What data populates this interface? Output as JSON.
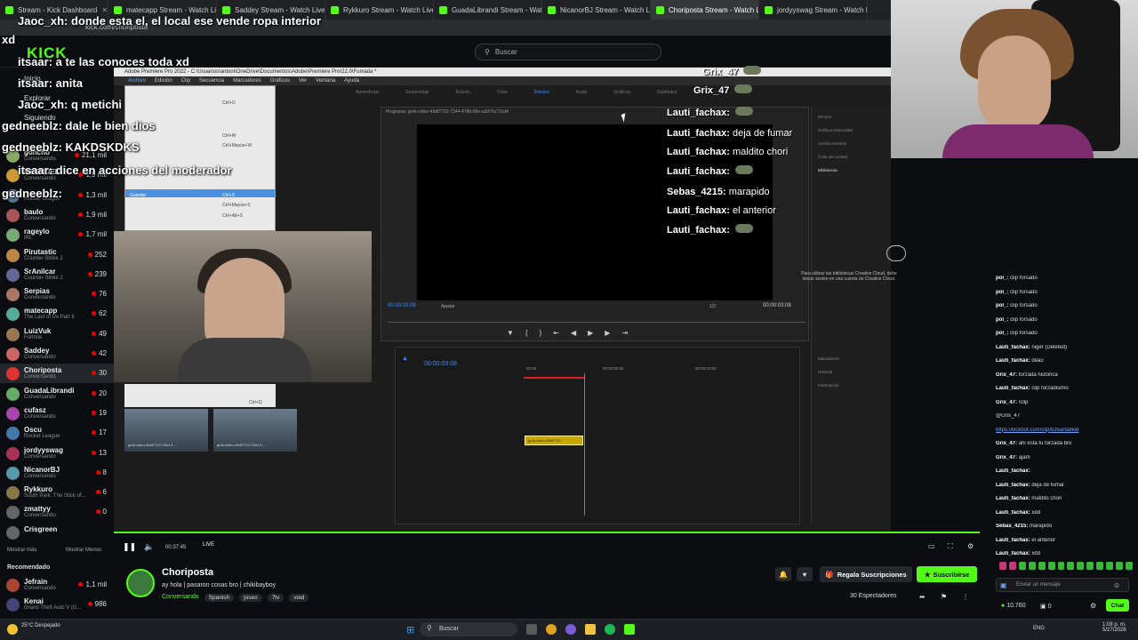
{
  "browser": {
    "tabs": [
      "Stream - Kick Dashboard",
      "matecapp Stream - Watch Live",
      "Saddey Stream - Watch Live o",
      "Rykkuro Stream - Watch Live",
      "GuadaLibrandi Stream - Watch",
      "NicanorBJ Stream - Watch Liv",
      "Choriposta Stream - Watch Li",
      "jordyyswag Stream - Watch Liv"
    ],
    "active_tab_index": 6,
    "url": "kick.com/choriposta"
  },
  "kick": {
    "logo": "KICK",
    "search_placeholder": "Buscar"
  },
  "overlay_chat": [
    {
      "text": "Jaoc_xh: donde esta el, el local ese vende ropa interior"
    },
    {
      "text": "xd"
    },
    {
      "text": "itsaar: a te las conoces toda xd"
    },
    {
      "text": "itsaar: anita"
    },
    {
      "text": "Jaoc_xh: q metichi"
    },
    {
      "text": "gedneeblz: dale le bien dios"
    },
    {
      "text": "gedneeblz: KAKDSKDKS"
    },
    {
      "text": "itsaar: dice en acciones del moderador"
    },
    {
      "text": "gedneeblz:"
    }
  ],
  "sidebar": {
    "menu": [
      "Inicio",
      "Explorar",
      "Siguiendo"
    ],
    "channels": [
      {
        "name": "goncho",
        "game": "Conversando",
        "count": "21,1 mil"
      },
      {
        "name": "MERNUEL",
        "game": "Conversando",
        "count": "1,9 mil"
      },
      {
        "name": "",
        "game": "Rocket League",
        "count": "1,3 mil"
      },
      {
        "name": "baulo",
        "game": "Conversando",
        "count": "1,9 mil"
      },
      {
        "name": "rageylo",
        "game": "IRL",
        "count": "1,7 mil"
      },
      {
        "name": "Pirutastic",
        "game": "Counter-Strike 2",
        "count": "252"
      },
      {
        "name": "SrAnilcar",
        "game": "Counter-Strike 2",
        "count": "239"
      },
      {
        "name": "Serpias",
        "game": "Conversando",
        "count": "76"
      },
      {
        "name": "matecapp",
        "game": "The Last of Us Part II",
        "count": "62"
      },
      {
        "name": "LuizVuk",
        "game": "Fortnite",
        "count": "49"
      },
      {
        "name": "Saddey",
        "game": "Conversando",
        "count": "42"
      },
      {
        "name": "Choriposta",
        "game": "Conversando",
        "count": "30"
      },
      {
        "name": "GuadaLibrandi",
        "game": "Conversando",
        "count": "20"
      },
      {
        "name": "cufasz",
        "game": "Conversando",
        "count": "19"
      },
      {
        "name": "Oscu",
        "game": "Rocket League",
        "count": "17"
      },
      {
        "name": "jordyyswag",
        "game": "Conversando",
        "count": "13"
      },
      {
        "name": "NicanorBJ",
        "game": "Conversando",
        "count": "8"
      },
      {
        "name": "Rykkuro",
        "game": "South Park: The Stick of...",
        "count": "6"
      },
      {
        "name": "zmattyy",
        "game": "Conversando",
        "count": "0"
      },
      {
        "name": "Crisgreen",
        "game": "",
        "count": ""
      }
    ],
    "show_more": "Mostrar más",
    "show_less": "Mostrar Menos",
    "recommended_title": "Recomendado",
    "recommended": [
      {
        "name": "Jefrain",
        "game": "Conversando",
        "count": "1,1 mil"
      },
      {
        "name": "Kenai",
        "game": "Grand Theft Auto V (G...",
        "count": "986"
      }
    ]
  },
  "premiere": {
    "title": "Adobe Premiere Pro 2022 - C:\\Usuarios\\antoni\\OneDrive\\Documentos\\Adobe\\Premiere Pro\\22.0\\Fumada *",
    "menu": [
      "Archivo",
      "Edición",
      "Clip",
      "Secuencia",
      "Marcadores",
      "Gráficos",
      "Ver",
      "Ventana",
      "Ayuda"
    ],
    "workspaces": [
      "Aprendizaje",
      "Ensamblaje",
      "Edición",
      "Color",
      "Efectos",
      "Audio",
      "Gráficos",
      "Subtítulos"
    ],
    "program_label": "Programa: grok-video-49df7722-7344-4786-89e-a2d76c72cd4",
    "tc_left": "00:00:03:08",
    "tc_right": "00:00:03:08",
    "fit": "Ajustar",
    "fraction": "1/2",
    "timeline_tc": "00:00:03:08",
    "timeline_marks": [
      "00:00",
      "00:00:05:00",
      "00:00:10:00"
    ],
    "clip_label": "grok-video-49df7722",
    "library_text": "Para utilizar las bibliotecas Creative Cloud, debe iniciar sesión en una cuenta de Creative Cloud.",
    "panel_tabs": [
      "Efectos",
      "Gráficos esenciales",
      "Sonido esencial",
      "Color de Lumetri",
      "Bibliotecas"
    ],
    "lower_panel": [
      "Marcadores",
      "Historial",
      "Información"
    ],
    "file_menu": [
      {
        "label": "Nuevo",
        "shortcut": ""
      },
      {
        "label": "Abrir proyecto...",
        "shortcut": "Ctrl+O"
      },
      {
        "label": "Abrir producción...",
        "shortcut": ""
      },
      {
        "label": "Abrir reciente",
        "shortcut": ""
      },
      {
        "label": "Cerrar",
        "shortcut": "Ctrl+W"
      },
      {
        "label": "Cerrar proyecto",
        "shortcut": "Ctrl+Mayús+W"
      },
      {
        "label": "Cerrar producción",
        "shortcut": ""
      },
      {
        "label": "Cerrar todos los proyectos",
        "shortcut": ""
      },
      {
        "label": "Actualizar todos los proyectos",
        "shortcut": ""
      },
      {
        "label": "Guardar",
        "shortcut": "Ctrl+S"
      },
      {
        "label": "Guardar como...",
        "shortcut": "Ctrl+Mayús+S"
      },
      {
        "label": "Guardar una copia...",
        "shortcut": "Ctrl+Alt+S"
      },
      {
        "label": "Guardar todo",
        "shortcut": ""
      }
    ],
    "file_menu_bottom": [
      {
        "label": "Administrador de proyectos...",
        "shortcut": ""
      },
      {
        "label": "Salir",
        "shortcut": "Ctrl+Q"
      }
    ],
    "thumb_labels": [
      "grok-video-49df7722-7344-4...",
      "grok-video-49df7722-7344-4..."
    ]
  },
  "video_chat": [
    {
      "user": "Grix_47",
      "text": ""
    },
    {
      "user": "Grix_47",
      "text": ""
    },
    {
      "user": "Lauti_fachax:",
      "text": ""
    },
    {
      "user": "Lauti_fachax:",
      "text": "deja de fumar"
    },
    {
      "user": "Lauti_fachax:",
      "text": "maldito chori"
    },
    {
      "user": "Lauti_fachax:",
      "text": ""
    },
    {
      "user": "Sebas_4215:",
      "text": "marapido"
    },
    {
      "user": "Lauti_fachax:",
      "text": "el anterior"
    },
    {
      "user": "Lauti_fachax:",
      "text": ""
    }
  ],
  "right_chat": [
    {
      "user": "pol_:",
      "text": "clip forsado"
    },
    {
      "user": "pol_:",
      "text": "clip forsado"
    },
    {
      "user": "pol_:",
      "text": "clip forsado"
    },
    {
      "user": "pol_:",
      "text": "clip forsado"
    },
    {
      "user": "pol_:",
      "text": "clip forsado"
    },
    {
      "user": "Lauti_fachax:",
      "text": "niger (Deleted)"
    },
    {
      "user": "Lauti_fachax:",
      "text": "deau"
    },
    {
      "user": "Grix_47:",
      "text": "forzada historica"
    },
    {
      "user": "Lauti_fachax:",
      "text": "clip forzadisimo"
    },
    {
      "user": "Grix_47:",
      "text": "!clip"
    },
    {
      "user": "",
      "text": "@Grix_47"
    },
    {
      "user": "",
      "text": "https://kickbot.com/clip/b35arta8kid"
    },
    {
      "user": "Grix_47:",
      "text": "ahi esta tu forzada bro"
    },
    {
      "user": "Grix_47:",
      "text": "ajam"
    },
    {
      "user": "Lauti_fachax:",
      "text": ""
    },
    {
      "user": "Lauti_fachax:",
      "text": "deja de fumar"
    },
    {
      "user": "Lauti_fachax:",
      "text": "maldito chori"
    },
    {
      "user": "Lauti_fachax:",
      "text": "xdd"
    },
    {
      "user": "Sebas_4215:",
      "text": "marapido"
    },
    {
      "user": "Lauti_fachax:",
      "text": "el anterior"
    },
    {
      "user": "Lauti_fachax:",
      "text": "xdd"
    }
  ],
  "player": {
    "time": "00:37:45",
    "live": "LIVE"
  },
  "stream": {
    "streamer": "Choriposta",
    "title": "ay hola | pasaron cosas bro | chikibayboy",
    "category": "Conversando",
    "tags": [
      "Spanish",
      "joseo",
      "7tv",
      "void"
    ],
    "viewers": "30 Espectadores",
    "gift_button": "Regala Suscripciones",
    "subscribe_button": "Suscribirse"
  },
  "chat_box": {
    "placeholder": "Enviar un mensaje",
    "points": "10.760",
    "zero": "0",
    "chat_button": "Chat"
  },
  "taskbar": {
    "weather": "25°C Despejado",
    "search": "Buscar",
    "lang": "ENG",
    "time": "1:08 p. m.",
    "date": "5/27/2026"
  },
  "colors": {
    "kick_green": "#53fc18",
    "premiere_blue": "#3c8dff",
    "live_red": "#eb0400"
  }
}
